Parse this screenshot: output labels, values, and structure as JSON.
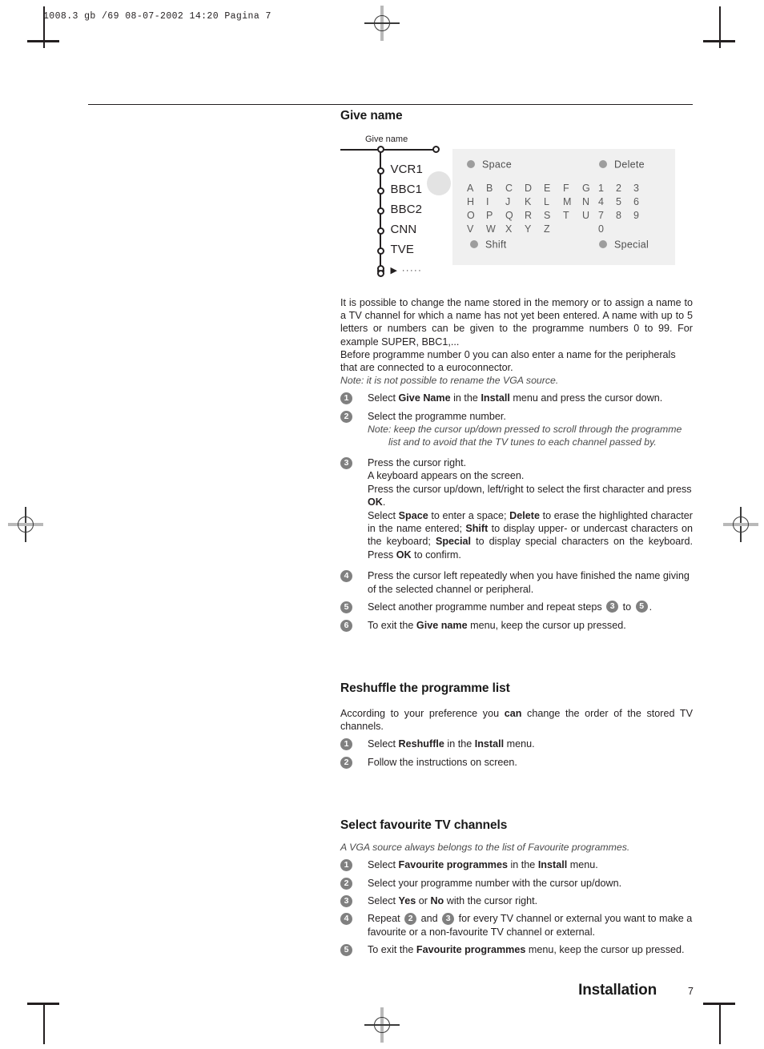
{
  "printer_slug": "1008.3 gb /69  08-07-2002  14:20  Pagina 7",
  "figure": {
    "caption": "Give name",
    "cursor_icon": "four-way-cursor-icon",
    "channels": [
      "VCR1",
      "BBC1",
      "BBC2",
      "CNN",
      "TVE"
    ],
    "more_marker": "▶ ·····",
    "keyboard": {
      "space_label": "Space",
      "delete_label": "Delete",
      "shift_label": "Shift",
      "special_label": "Special",
      "letter_rows": [
        [
          "A",
          "B",
          "C",
          "D",
          "E",
          "F",
          "G"
        ],
        [
          "H",
          "I",
          "J",
          "K",
          "L",
          "M",
          "N"
        ],
        [
          "O",
          "P",
          "Q",
          "R",
          "S",
          "T",
          "U"
        ],
        [
          "V",
          "W",
          "X",
          "Y",
          "Z"
        ]
      ],
      "number_rows": [
        [
          "1",
          "2",
          "3"
        ],
        [
          "4",
          "5",
          "6"
        ],
        [
          "7",
          "8",
          "9"
        ],
        [
          "0"
        ]
      ]
    }
  },
  "sections": {
    "give_name": {
      "heading": "Give name",
      "intro_p1": "It is possible to change the name stored in the memory or to assign a name to a TV channel for which a name has not yet been entered. A name with up to 5 letters or numbers can be given to the programme numbers 0 to 99. For example SUPER, BBC1,...",
      "intro_p2": "Before programme number 0 you can also enter a name for the peripherals that are connected to a euroconnector.",
      "note": "Note: it is not possible to rename the VGA source.",
      "step1_a": "Select ",
      "step1_b": "Give Name",
      "step1_c": " in the ",
      "step1_d": "Install",
      "step1_e": " menu and press the cursor down.",
      "step2_text": "Select the programme number.",
      "step2_note": "Note: keep the cursor up/down pressed to scroll through the programme list and to avoid that the TV tunes to each channel passed by.",
      "step3_l1": "Press the cursor right.",
      "step3_l2": "A keyboard appears on the screen.",
      "step3_l3a": "Press the cursor up/down, left/right to select the first character and press ",
      "step3_l3b": "OK",
      "step3_l3c": ".",
      "step3_l4a": "Select ",
      "step3_l4b": "Space",
      "step3_l4c": " to enter a space; ",
      "step3_l4d": "Delete",
      "step3_l4e": " to erase the highlighted character in the name entered; ",
      "step3_l4f": "Shift",
      "step3_l4g": " to display upper- or undercast characters on the keyboard; ",
      "step3_l4h": "Special",
      "step3_l4i": " to display special characters on the keyboard. Press ",
      "step3_l4j": "OK",
      "step3_l4k": " to confirm.",
      "step4_text": "Press the cursor left repeatedly when you have finished the name giving of the selected channel or peripheral.",
      "step5_a": "Select another programme number and repeat steps ",
      "step5_ref1": "3",
      "step5_b": " to ",
      "step5_ref2": "5",
      "step5_c": ".",
      "step6_a": "To exit the ",
      "step6_b": "Give name",
      "step6_c": " menu, keep the cursor up pressed."
    },
    "reshuffle": {
      "heading": "Reshuffle the programme list",
      "intro_a": "According to your preference you ",
      "intro_b": "can",
      "intro_c": " change the order of the stored TV channels.",
      "step1_a": "Select ",
      "step1_b": "Reshuffle",
      "step1_c": " in the ",
      "step1_d": "Install",
      "step1_e": " menu.",
      "step2_text": "Follow the instructions on screen."
    },
    "favourite": {
      "heading": "Select favourite TV channels",
      "note": "A VGA source always belongs to the list of Favourite programmes.",
      "step1_a": "Select ",
      "step1_b": "Favourite programmes",
      "step1_c": " in the ",
      "step1_d": "Install",
      "step1_e": " menu.",
      "step2_text": "Select your programme number with the cursor up/down.",
      "step3_a": "Select ",
      "step3_b": "Yes",
      "step3_c": " or ",
      "step3_d": "No",
      "step3_e": " with the cursor right.",
      "step4_a": "Repeat ",
      "step4_ref1": "2",
      "step4_b": " and ",
      "step4_ref2": "3",
      "step4_c": " for every TV channel or external you want to make a favourite or a non-favourite TV channel or external.",
      "step5_a": "To exit the ",
      "step5_b": "Favourite programmes",
      "step5_c": " menu, keep the cursor up pressed."
    }
  },
  "footer": {
    "title": "Installation",
    "page_number": "7"
  },
  "step_numbers": {
    "n1": "1",
    "n2": "2",
    "n3": "3",
    "n4": "4",
    "n5": "5",
    "n6": "6"
  },
  "colors": {
    "ink": "#231f20",
    "step_badge": "#808080",
    "panel_bg": "#f0f0f0",
    "key_text": "#5a5a5a"
  }
}
